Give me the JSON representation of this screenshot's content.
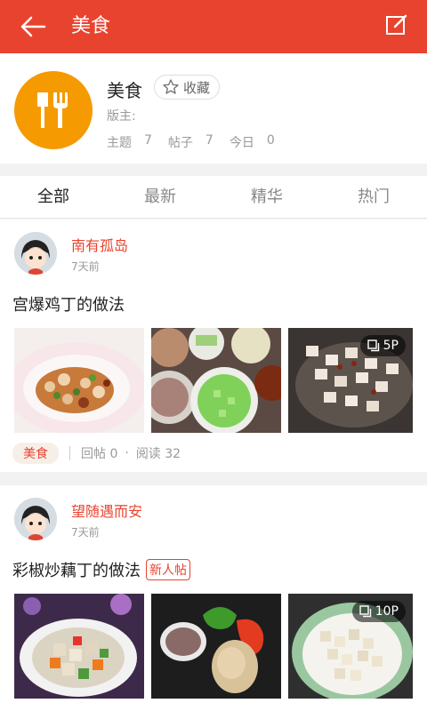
{
  "topbar": {
    "title": "美食"
  },
  "forum": {
    "name": "美食",
    "favorite_label": "收藏",
    "moderator_label": "版主:",
    "stats": [
      {
        "label": "主题",
        "value": "7"
      },
      {
        "label": "帖子",
        "value": "7"
      },
      {
        "label": "今日",
        "value": "0"
      }
    ]
  },
  "tabs": [
    {
      "label": "全部",
      "active": true
    },
    {
      "label": "最新",
      "active": false
    },
    {
      "label": "精华",
      "active": false
    },
    {
      "label": "热门",
      "active": false
    }
  ],
  "posts": [
    {
      "author": "南有孤岛",
      "time": "7天前",
      "title": "宫爆鸡丁的做法",
      "badge": "",
      "photo_count": "5P",
      "tag": "美食",
      "replies": "回帖 0",
      "reads": "阅读 32"
    },
    {
      "author": "望随遇而安",
      "time": "7天前",
      "title": "彩椒炒藕丁的做法",
      "badge": "新人帖",
      "photo_count": "10P"
    }
  ],
  "colors": {
    "accent": "#e8432f",
    "forum_logo": "#f59a00"
  }
}
